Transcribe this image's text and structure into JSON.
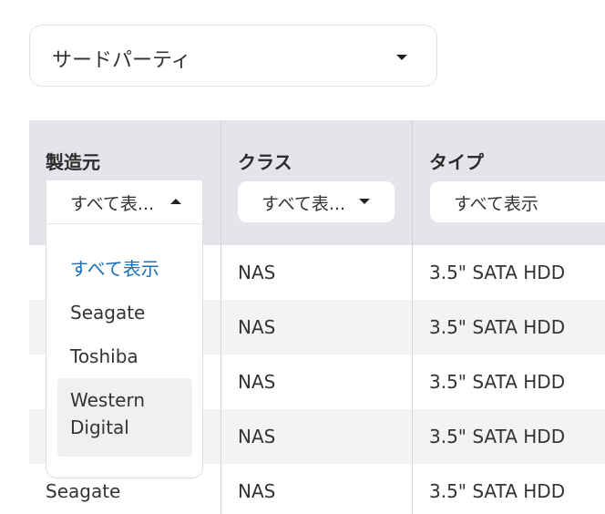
{
  "top_select": {
    "value": "サードパーティ",
    "icon": "chevron-down-icon"
  },
  "table": {
    "columns": [
      {
        "title": "製造元",
        "filter": "すべて表...",
        "filter_open": true
      },
      {
        "title": "クラス",
        "filter": "すべて表...",
        "filter_open": false
      },
      {
        "title": "タイプ",
        "filter": "すべて表示",
        "filter_open": false
      }
    ],
    "rows": [
      {
        "maker": "",
        "class": "NAS",
        "type": "3.5\" SATA HDD"
      },
      {
        "maker": "",
        "class": "NAS",
        "type": "3.5\" SATA HDD"
      },
      {
        "maker": "",
        "class": "NAS",
        "type": "3.5\" SATA HDD"
      },
      {
        "maker": "",
        "class": "NAS",
        "type": "3.5\" SATA HDD"
      },
      {
        "maker": "Seagate",
        "class": "NAS",
        "type": "3.5\" SATA HDD"
      }
    ]
  },
  "maker_dropdown": {
    "options": [
      "すべて表示",
      "Seagate",
      "Toshiba",
      "Western Digital"
    ],
    "selected": "すべて表示",
    "highlighted": "Western Digital"
  },
  "colors": {
    "header_bg": "#e4e5ea",
    "selected_option": "#1a6fb5",
    "row_alt": "#f3f3f3"
  }
}
